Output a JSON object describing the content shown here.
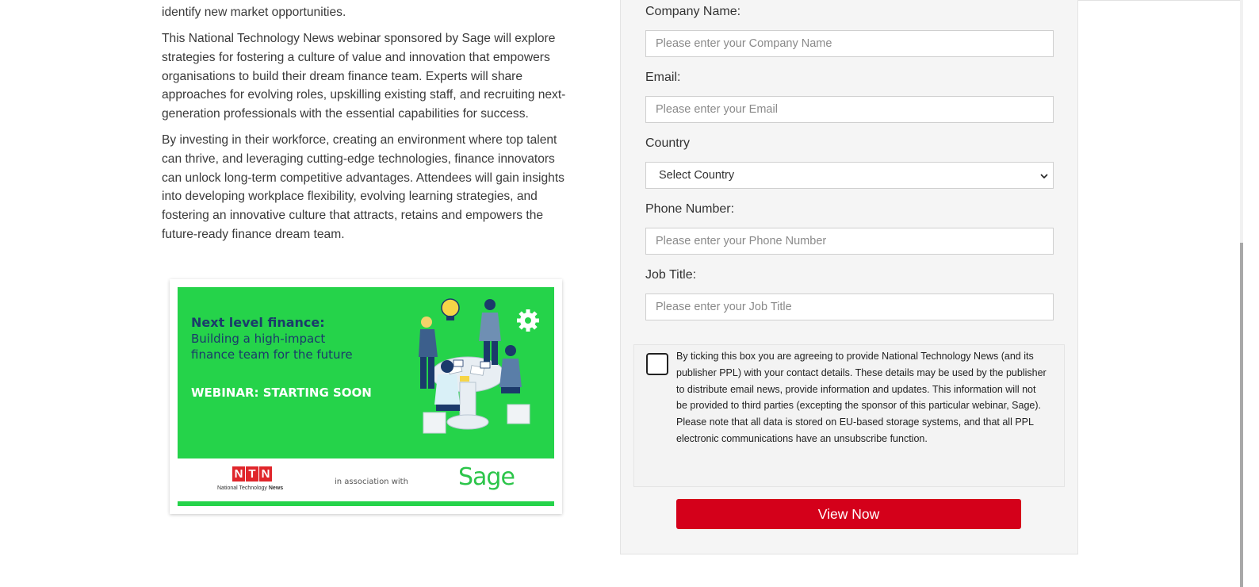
{
  "article": {
    "para1": "identify new market opportunities.",
    "para2": "This National Technology News webinar sponsored by Sage will explore strategies for fostering a culture of value and innovation that empowers organisations to build their dream finance team. Experts will share approaches for evolving roles, upskilling existing staff, and recruiting next-generation professionals with the essential capabilities for success.",
    "para3": "By investing in their workforce, creating an environment where top talent can thrive, and leveraging cutting-edge technologies, finance innovators can unlock long-term competitive advantages. Attendees will gain insights into developing workplace flexibility, evolving learning strategies, and fostering an innovative culture that attracts, retains and empowers the future-ready finance dream team."
  },
  "banner": {
    "title": "Next level finance:",
    "subtitle_line1": "Building a high-impact",
    "subtitle_line2": "finance team for the future",
    "status": "WEBINAR: STARTING SOON",
    "ntn_letters": [
      "N",
      "T",
      "N"
    ],
    "ntn_sub_prefix": "National Technology",
    "ntn_sub_bold": "News",
    "association": "in association with",
    "sponsor": "Sage",
    "green": "#25d34a"
  },
  "form": {
    "company": {
      "label": "Company Name:",
      "placeholder": "Please enter your Company Name"
    },
    "email": {
      "label": "Email:",
      "placeholder": "Please enter your Email"
    },
    "country": {
      "label": "Country",
      "selected": "Select Country"
    },
    "phone": {
      "label": "Phone Number:",
      "placeholder": "Please enter your Phone Number"
    },
    "job": {
      "label": "Job Title:",
      "placeholder": "Please enter your Job Title"
    },
    "consent": {
      "checked": false,
      "text": "By ticking this box you are agreeing to provide National Technology News (and its publisher PPL) with your contact details. These details may be used by the publisher to distribute email news, provide information and updates. This information will not be provided to third parties (excepting the sponsor of this particular webinar, Sage). Please note that all data is stored on EU-based storage systems, and that all PPL electronic communications have an unsubscribe function."
    },
    "submit_label": "View Now",
    "submit_color": "#d4001a"
  },
  "icons": {
    "select_arrow": "chevron-down-icon",
    "gear": "gear-icon",
    "lightbulb": "lightbulb-icon"
  }
}
